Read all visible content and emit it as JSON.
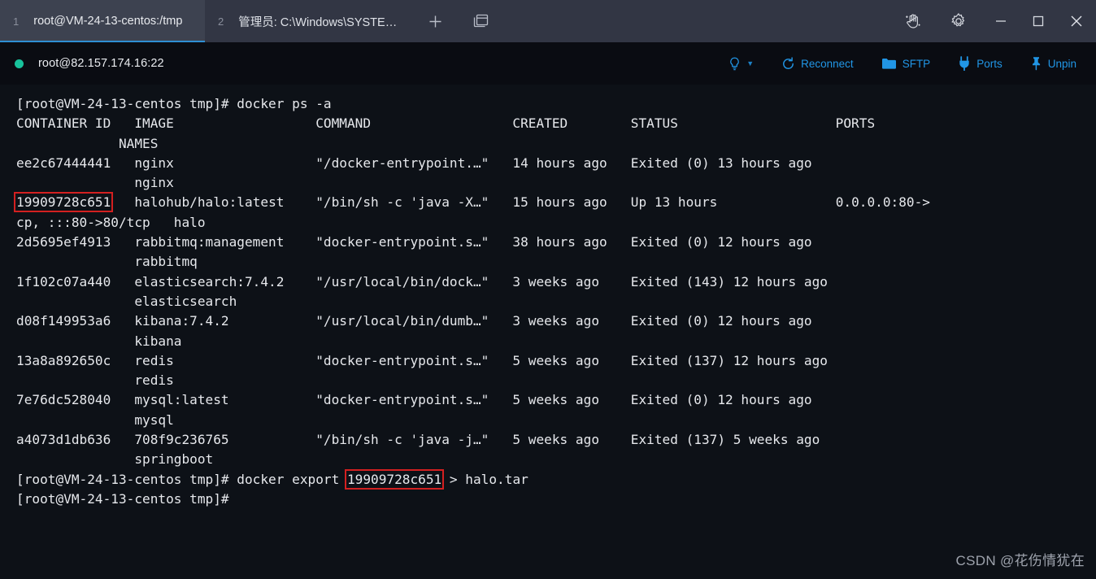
{
  "window": {
    "tabs": [
      {
        "index": "1",
        "title": "root@VM-24-13-centos:/tmp",
        "active": true
      },
      {
        "index": "2",
        "title": "管理员: C:\\Windows\\SYSTE…",
        "active": false
      }
    ],
    "new_tab_label": "+",
    "panes_icon": "windows-panes-icon",
    "controls": {
      "hand_label": "hand-plus-icon",
      "settings_label": "gear-icon",
      "minimize_label": "—",
      "maximize_label": "▢",
      "close_label": "✕"
    },
    "accent_color": "#2f8fd4",
    "titlebar_color": "#323644",
    "active_tab_color": "#3d4250"
  },
  "session": {
    "host": "root@82.157.174.16:22",
    "status_color": "#18c29c",
    "link_color": "#2196e6",
    "actions": [
      {
        "label": "",
        "icon": "lightbulb-icon",
        "has_caret": true
      },
      {
        "label": "Reconnect",
        "icon": "refresh-icon",
        "has_caret": false
      },
      {
        "label": "SFTP",
        "icon": "folder-icon",
        "has_caret": false
      },
      {
        "label": "Ports",
        "icon": "plug-icon",
        "has_caret": false
      },
      {
        "label": "Unpin",
        "icon": "pin-icon",
        "has_caret": false
      }
    ]
  },
  "terminal": {
    "background": "#0d1117",
    "foreground": "#e6e8ec",
    "highlight_color": "#d32020",
    "prompt": "[root@VM-24-13-centos tmp]#",
    "command": "docker ps -a",
    "highlighted_container_id": "19909728c651",
    "columns": [
      "CONTAINER ID",
      "IMAGE",
      "COMMAND",
      "CREATED",
      "STATUS",
      "PORTS",
      "NAMES"
    ],
    "header_line_1": "CONTAINER ID   IMAGE                  COMMAND                  CREATED        STATUS                    PORTS",
    "header_line_2": "             NAMES",
    "containers": [
      {
        "id": "ee2c67444441",
        "image": "nginx",
        "command": "\"/docker-entrypoint.…\"",
        "created": "14 hours ago",
        "status": "Exited (0) 13 hours ago",
        "ports": "",
        "names": "nginx",
        "highlighted": false
      },
      {
        "id": "19909728c651",
        "image": "halohub/halo:latest",
        "command": "\"/bin/sh -c 'java -X…\"",
        "created": "15 hours ago",
        "status": "Up 13 hours",
        "ports": "0.0.0.0:80->80/tcp, :::80->80/tcp",
        "names": "halo",
        "highlighted": true
      },
      {
        "id": "2d5695ef4913",
        "image": "rabbitmq:management",
        "command": "\"docker-entrypoint.s…\"",
        "created": "38 hours ago",
        "status": "Exited (0) 12 hours ago",
        "ports": "",
        "names": "rabbitmq",
        "highlighted": false
      },
      {
        "id": "1f102c07a440",
        "image": "elasticsearch:7.4.2",
        "command": "\"/usr/local/bin/dock…\"",
        "created": "3 weeks ago",
        "status": "Exited (143) 12 hours ago",
        "ports": "",
        "names": "elasticsearch",
        "highlighted": false
      },
      {
        "id": "d08f149953a6",
        "image": "kibana:7.4.2",
        "command": "\"/usr/local/bin/dumb…\"",
        "created": "3 weeks ago",
        "status": "Exited (0) 12 hours ago",
        "ports": "",
        "names": "kibana",
        "highlighted": false
      },
      {
        "id": "13a8a892650c",
        "image": "redis",
        "command": "\"docker-entrypoint.s…\"",
        "created": "5 weeks ago",
        "status": "Exited (137) 12 hours ago",
        "ports": "",
        "names": "redis",
        "highlighted": false
      },
      {
        "id": "7e76dc528040",
        "image": "mysql:latest",
        "command": "\"docker-entrypoint.s…\"",
        "created": "5 weeks ago",
        "status": "Exited (0) 12 hours ago",
        "ports": "",
        "names": "mysql",
        "highlighted": false
      },
      {
        "id": "a4073d1db636",
        "image": "708f9c236765",
        "command": "\"/bin/sh -c 'java -j…\"",
        "created": "5 weeks ago",
        "status": "Exited (137) 5 weeks ago",
        "ports": "",
        "names": "springboot",
        "highlighted": false
      }
    ],
    "lines": [
      {
        "text": "[root@VM-24-13-centos tmp]# docker ps -a"
      },
      {
        "text": "CONTAINER ID   IMAGE                  COMMAND                  CREATED        STATUS                    PORTS"
      },
      {
        "text": "             NAMES"
      },
      {
        "text": "ee2c67444441   nginx                  \"/docker-entrypoint.…\"   14 hours ago   Exited (0) 13 hours ago"
      },
      {
        "text": "               nginx"
      },
      {
        "pre": "",
        "hl": "19909728c651",
        "post": "   halohub/halo:latest    \"/bin/sh -c 'java -X…\"   15 hours ago   Up 13 hours               0.0.0.0:80->"
      },
      {
        "text": "cp, :::80->80/tcp   halo"
      },
      {
        "text": "2d5695ef4913   rabbitmq:management    \"docker-entrypoint.s…\"   38 hours ago   Exited (0) 12 hours ago"
      },
      {
        "text": "               rabbitmq"
      },
      {
        "text": "1f102c07a440   elasticsearch:7.4.2    \"/usr/local/bin/dock…\"   3 weeks ago    Exited (143) 12 hours ago"
      },
      {
        "text": "               elasticsearch"
      },
      {
        "text": "d08f149953a6   kibana:7.4.2           \"/usr/local/bin/dumb…\"   3 weeks ago    Exited (0) 12 hours ago"
      },
      {
        "text": "               kibana"
      },
      {
        "text": "13a8a892650c   redis                  \"docker-entrypoint.s…\"   5 weeks ago    Exited (137) 12 hours ago"
      },
      {
        "text": "               redis"
      },
      {
        "text": "7e76dc528040   mysql:latest           \"docker-entrypoint.s…\"   5 weeks ago    Exited (0) 12 hours ago"
      },
      {
        "text": "               mysql"
      },
      {
        "text": "a4073d1db636   708f9c236765           \"/bin/sh -c 'java -j…\"   5 weeks ago    Exited (137) 5 weeks ago"
      },
      {
        "text": "               springboot"
      },
      {
        "pre": "[root@VM-24-13-centos tmp]# docker export ",
        "hl": "19909728c651",
        "post": " > halo.tar"
      },
      {
        "text": "[root@VM-24-13-centos tmp]#"
      }
    ]
  },
  "watermark": "CSDN @花伤情犹在"
}
